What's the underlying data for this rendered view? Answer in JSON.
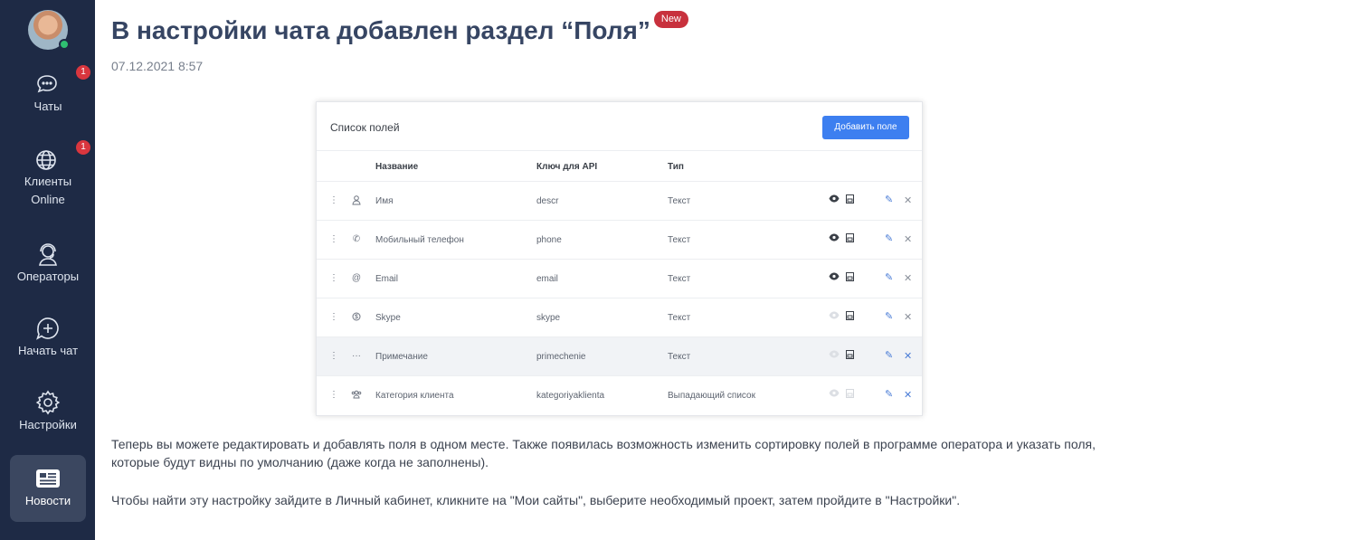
{
  "sidebar": {
    "items": [
      {
        "label": "Чаты",
        "icon": "chat-icon",
        "badge": "1"
      },
      {
        "label": "Клиенты Online",
        "icon": "globe-icon",
        "badge": "1"
      },
      {
        "label": "Операторы",
        "icon": "operator-icon"
      },
      {
        "label": "Начать чат",
        "icon": "start-chat-icon"
      },
      {
        "label": "Настройки",
        "icon": "gear-icon"
      },
      {
        "label": "Новости",
        "icon": "news-icon",
        "active": true
      }
    ]
  },
  "article": {
    "title": "В настройки чата добавлен раздел “Поля”",
    "badge": "New",
    "date": "07.12.2021 8:57",
    "paragraph1": "Теперь вы можете редактировать и добавлять поля в одном месте. Также появилась возможность изменить сортировку полей в программе оператора и указать поля, которые будут видны по умолчанию (даже когда не заполнены).",
    "paragraph2": "Чтобы найти эту настройку зайдите в Личный кабинет, кликните на \"Мои сайты\", выберите необходимый проект, затем пройдите в \"Настройки\"."
  },
  "fields_screenshot": {
    "title": "Список полей",
    "add_button": "Добавить поле",
    "columns": {
      "name": "Название",
      "key": "Ключ для API",
      "type": "Тип"
    },
    "rows": [
      {
        "icon": "person-icon",
        "name": "Имя",
        "key": "descr",
        "type": "Текст",
        "visible": true
      },
      {
        "icon": "phone-icon",
        "name": "Мобильный телефон",
        "key": "phone",
        "type": "Текст",
        "visible": true
      },
      {
        "icon": "at-icon",
        "name": "Email",
        "key": "email",
        "type": "Текст",
        "visible": true
      },
      {
        "icon": "skype-icon",
        "name": "Skype",
        "key": "skype",
        "type": "Текст",
        "visible": false
      },
      {
        "icon": "dots-icon",
        "name": "Примечание",
        "key": "primechenie",
        "type": "Текст",
        "visible": false
      },
      {
        "icon": "group-icon",
        "name": "Категория клиента",
        "key": "kategoriyaklienta",
        "type": "Выпадающий список",
        "visible": false
      }
    ]
  },
  "colors": {
    "sidebar_bg": "#1e2a45",
    "badge_red": "#d9363e",
    "title": "#364563",
    "button_blue": "#3d7ff0"
  }
}
